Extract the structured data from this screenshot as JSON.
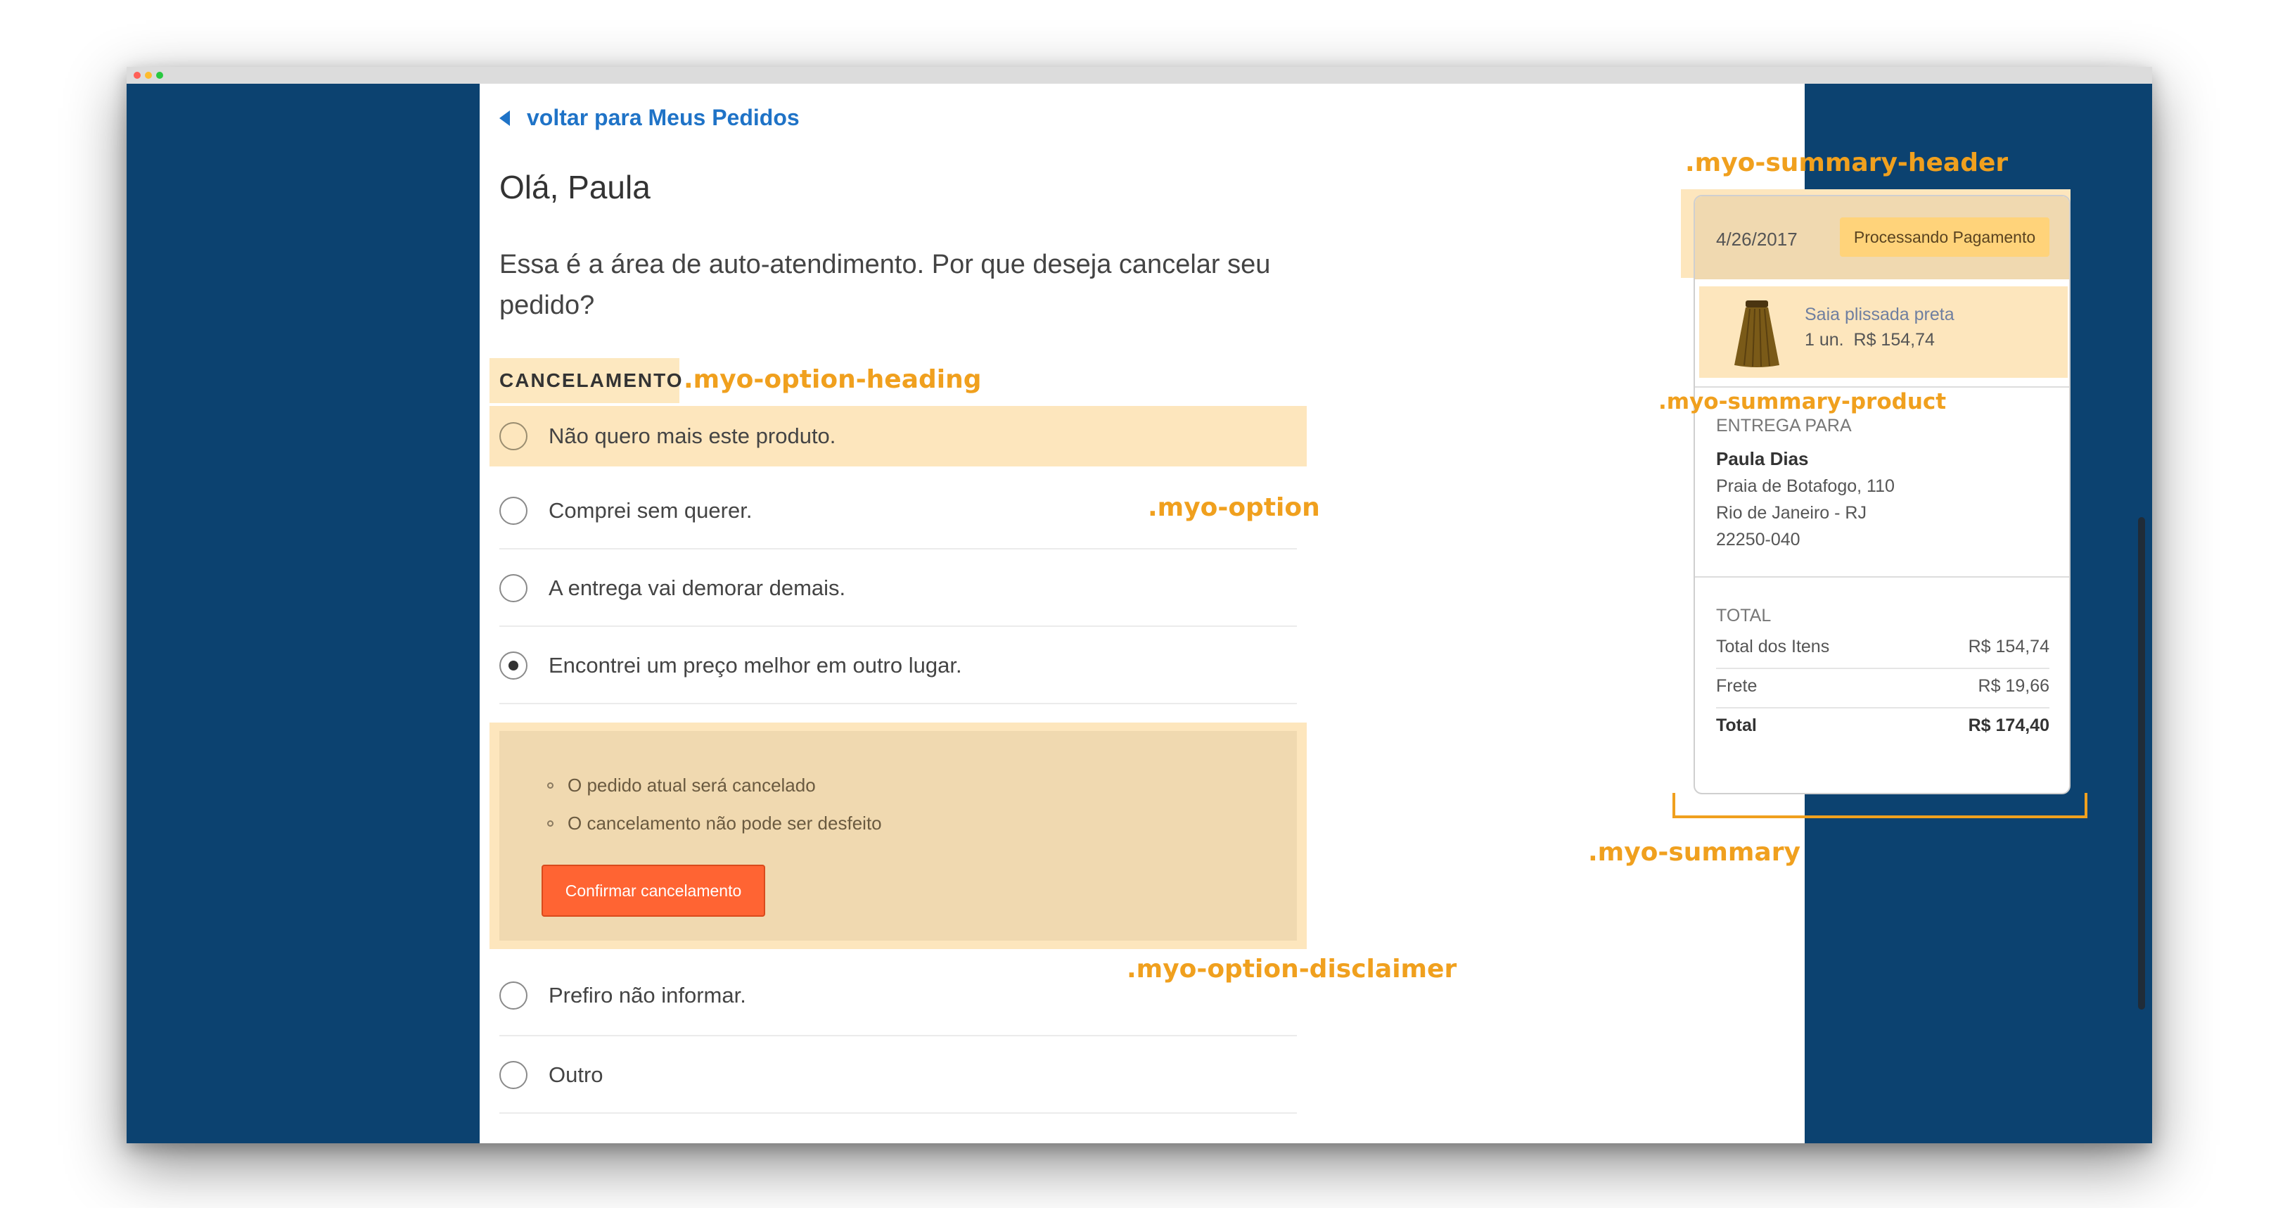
{
  "back_link": "voltar para Meus Pedidos",
  "greeting": "Olá, Paula",
  "intro": "Essa é a área de auto-atendimento. Por que deseja cancelar seu pedido?",
  "option_heading": "CANCELAMENTO",
  "options": [
    {
      "label": "Não quero mais este produto.",
      "selected": false,
      "highlighted": true
    },
    {
      "label": "Comprei sem querer.",
      "selected": false
    },
    {
      "label": "A entrega vai demorar demais.",
      "selected": false
    },
    {
      "label": "Encontrei um preço melhor em outro lugar.",
      "selected": true
    },
    {
      "label": "Prefiro não informar.",
      "selected": false
    },
    {
      "label": "Outro",
      "selected": false
    }
  ],
  "disclaimer": {
    "bullets": [
      "O pedido atual será cancelado",
      "O cancelamento não pode ser desfeito"
    ],
    "confirm_button": "Confirmar cancelamento"
  },
  "summary": {
    "date": "4/26/2017",
    "status": "Processando Pagamento",
    "product": {
      "name": "Saia plissada preta",
      "qty": "1 un.",
      "price": "R$ 154,74"
    },
    "delivery_label": "ENTREGA PARA",
    "recipient": "Paula Dias",
    "address": [
      "Praia de Botafogo, 110",
      "Rio de Janeiro - RJ",
      "22250-040"
    ],
    "total_label": "TOTAL",
    "totals": [
      {
        "label": "Total dos Itens",
        "value": "R$ 154,74"
      },
      {
        "label": "Frete",
        "value": "R$ 19,66"
      },
      {
        "label": "Total",
        "value": "R$ 174,40"
      }
    ]
  },
  "annotations": {
    "summary_header": ".myo-summary-header",
    "option_heading": ".myo-option-heading",
    "option": ".myo-option",
    "summary_product": ".myo-summary-product",
    "option_disclaimer": ".myo-option-disclaimer",
    "summary": ".myo-summary"
  },
  "colors": {
    "background": "#0c4270",
    "highlight": "#fde6bd",
    "annotation": "#f0a01e",
    "link": "#1f73c7",
    "confirm_button": "#ff6433",
    "status_badge": "#ffd37a"
  },
  "icons": {
    "back": "triangle-left-icon",
    "radio": "radio-icon",
    "product": "skirt-image"
  }
}
